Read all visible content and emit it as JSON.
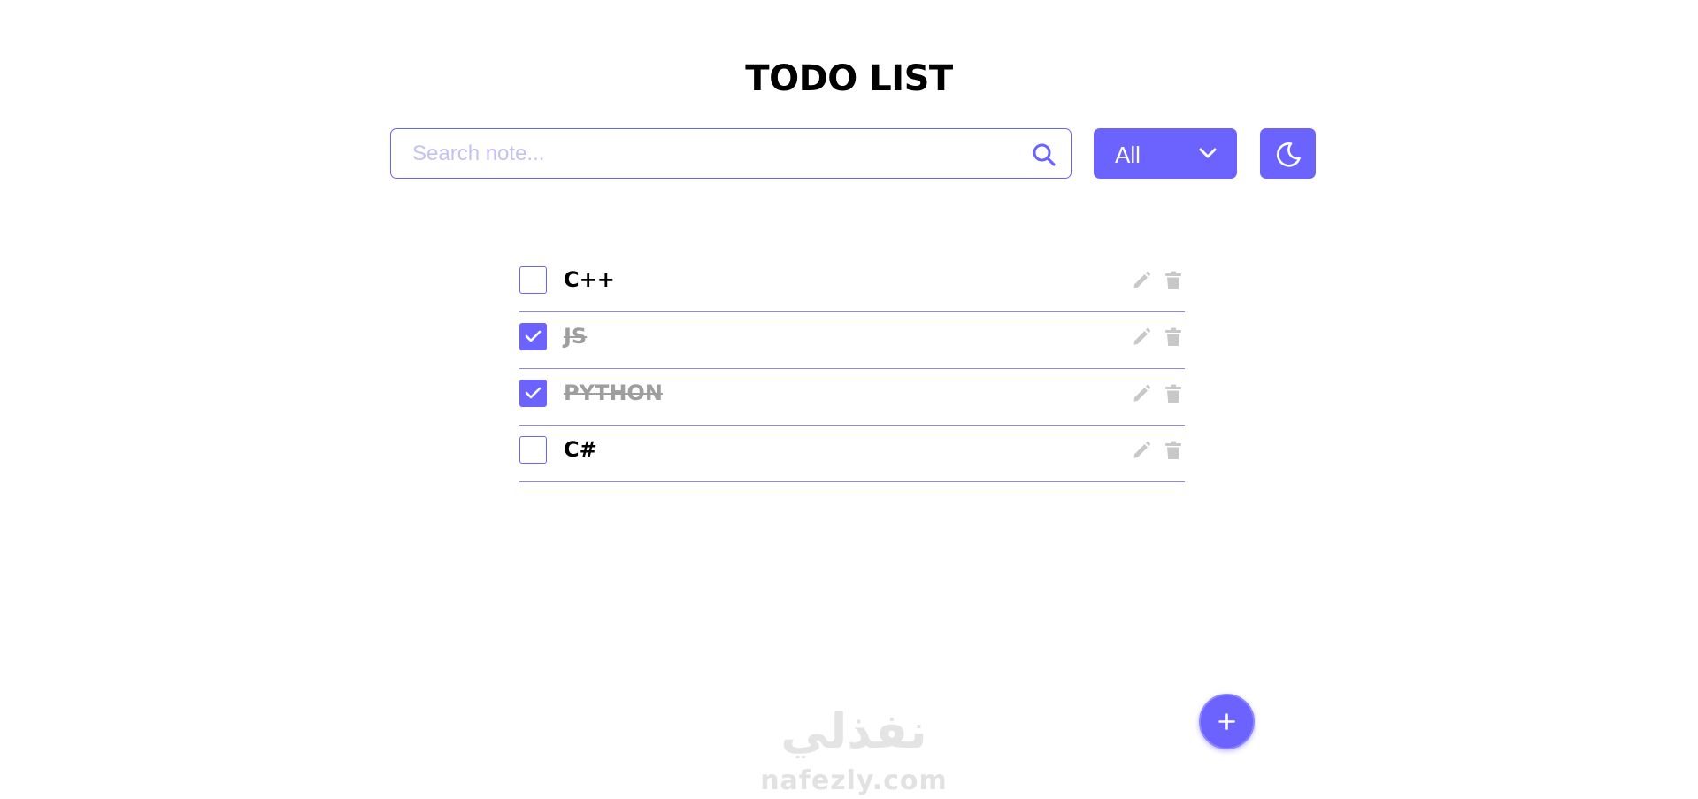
{
  "header": {
    "title": "TODO LIST"
  },
  "search": {
    "placeholder": "Search note...",
    "value": "",
    "icon": "search-icon"
  },
  "filter": {
    "selected": "All",
    "icon": "chevron-down-icon"
  },
  "theme_toggle": {
    "icon": "moon-icon"
  },
  "todos": [
    {
      "text": "C++",
      "completed": false
    },
    {
      "text": "JS",
      "completed": true
    },
    {
      "text": "PYTHON",
      "completed": true
    },
    {
      "text": "C#",
      "completed": false
    }
  ],
  "add_button": {
    "icon": "plus-icon"
  },
  "watermark": {
    "text": "nafezly.com",
    "logo": "نفذلي"
  },
  "colors": {
    "accent": "#6c63ff",
    "placeholder": "#c4c1f5",
    "completed_text": "#9e9e9e",
    "action_icon": "#c8c8c8",
    "divider": "#8d87e8"
  }
}
